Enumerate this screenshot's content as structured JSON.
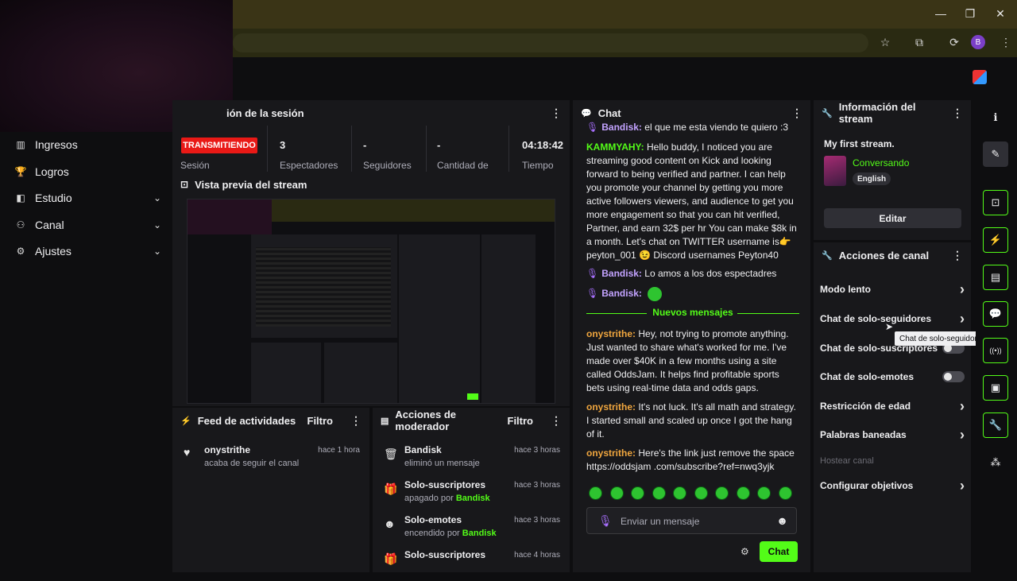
{
  "browser": {
    "window_controls": [
      "—",
      "❐",
      "✕"
    ],
    "toolbar_icons": [
      "☆",
      "⧉",
      "⟳"
    ],
    "profile_initial": "B"
  },
  "leftnav": {
    "items": [
      {
        "label": "Ingresos",
        "icon": "chart-icon",
        "glyph": "▥",
        "expandable": false
      },
      {
        "label": "Logros",
        "icon": "trophy-icon",
        "glyph": "🏆",
        "expandable": false
      },
      {
        "label": "Estudio",
        "icon": "studio-icon",
        "glyph": "◧",
        "expandable": true
      },
      {
        "label": "Canal",
        "icon": "users-icon",
        "glyph": "⚇",
        "expandable": true
      },
      {
        "label": "Ajustes",
        "icon": "gear-icon",
        "glyph": "⚙",
        "expandable": true
      }
    ]
  },
  "session": {
    "title": "ión de la sesión",
    "live_badge": "TRANSMITIENDO",
    "stats": [
      {
        "value": "",
        "label": "Sesión"
      },
      {
        "value": "3",
        "label": "Espectadores"
      },
      {
        "value": "-",
        "label": "Seguidores"
      },
      {
        "value": "-",
        "label": "Cantidad de"
      },
      {
        "value": "04:18:42",
        "label": "Tiempo"
      }
    ]
  },
  "preview": {
    "title": "Vista previa del stream"
  },
  "feed": {
    "title": "Feed de actividades",
    "filter": "Filtro",
    "items": [
      {
        "user": "onystrithe",
        "action": "acaba de seguir el canal",
        "time": "hace 1 hora"
      }
    ]
  },
  "mod_actions": {
    "title": "Acciones de moderador",
    "filter": "Filtro",
    "items": [
      {
        "title": "Bandisk",
        "sub": "eliminó un mensaje",
        "by": "",
        "time": "hace 3 horas",
        "icon": "trash-icon",
        "glyph": "🗑"
      },
      {
        "title": "Solo-suscriptores",
        "sub": "apagado por",
        "by": "Bandisk",
        "time": "hace 3 horas",
        "icon": "gift-icon",
        "glyph": "🎁"
      },
      {
        "title": "Solo-emotes",
        "sub": "encendido por",
        "by": "Bandisk",
        "time": "hace 3 horas",
        "icon": "smile-icon",
        "glyph": "☻"
      },
      {
        "title": "Solo-suscriptores",
        "sub": "",
        "by": "",
        "time": "hace 4 horas",
        "icon": "gift-icon",
        "glyph": "🎁"
      }
    ]
  },
  "chat": {
    "title": "Chat",
    "messages": [
      {
        "user": "Bandisk",
        "color": "purple",
        "text": "el que me esta viendo te quiero :3",
        "mic": true
      },
      {
        "user": "KAMMYAHY",
        "color": "green",
        "text": "Hello buddy, I noticed you are streaming good content on Kick and looking forward to being verified and partner. I can help you promote your channel by getting you more active followers viewers, and audience to get you more engagement so that you can hit verified, Partner, and earn 32$ per hr You can make $8k in a month. Let's chat on TWITTER username is👉 peyton_001 😉 Discord usernames Peyton40",
        "mic": false
      },
      {
        "user": "Bandisk",
        "color": "purple",
        "text": "Lo amos a los dos espectadres",
        "mic": true
      },
      {
        "user": "Bandisk",
        "color": "purple",
        "text": "",
        "mic": true
      }
    ],
    "new_messages_label": "Nuevos mensajes",
    "new_messages": [
      {
        "user": "onystrithe",
        "text": "Hey, not trying to promote anything. Just wanted to share what's worked for me. I've made over $40K in a few months using a site called OddsJam. It helps find profitable sports bets using real-time data and odds gaps."
      },
      {
        "user": "onystrithe",
        "text": "It's not luck. It's all math and strategy. I started small and scaled up once I got the hang of it."
      },
      {
        "user": "onystrithe",
        "text": "Here's the link just remove the space https://oddsjam .com/subscribe?ref=nwq3yjk"
      }
    ],
    "input_placeholder": "Enviar un mensaje",
    "send_label": "Chat"
  },
  "stream_info": {
    "title": "Información del stream",
    "stream_title": "My first stream.",
    "category": "Conversando",
    "language": "English",
    "edit_label": "Editar"
  },
  "channel_actions": {
    "title": "Acciones de canal",
    "items": [
      {
        "label": "Modo lento",
        "type": "chevron",
        "disabled": false
      },
      {
        "label": "Chat de solo-seguidores",
        "type": "chevron",
        "disabled": false
      },
      {
        "label": "Chat de solo-suscriptores",
        "type": "toggle",
        "disabled": false
      },
      {
        "label": "Chat de solo-emotes",
        "type": "toggle",
        "disabled": false
      },
      {
        "label": "Restricción de edad",
        "type": "chevron",
        "disabled": false
      },
      {
        "label": "Palabras baneadas",
        "type": "chevron",
        "disabled": false
      },
      {
        "label": "Hostear canal",
        "type": "none",
        "disabled": true
      },
      {
        "label": "Configurar objetivos",
        "type": "chevron",
        "disabled": false
      }
    ],
    "tooltip": "Chat de solo-seguidores"
  },
  "rightbar": {
    "buttons": [
      {
        "icon": "info-icon",
        "glyph": "ℹ",
        "style": "plain"
      },
      {
        "icon": "pencil-icon",
        "glyph": "✎",
        "style": "fill"
      },
      {
        "icon": "capture-icon",
        "glyph": "⊡",
        "style": "outline"
      },
      {
        "icon": "bolt-icon",
        "glyph": "⚡",
        "style": "outline"
      },
      {
        "icon": "notes-icon",
        "glyph": "▤",
        "style": "outline"
      },
      {
        "icon": "chat-icon",
        "glyph": "💬",
        "style": "outline"
      },
      {
        "icon": "broadcast-icon",
        "glyph": "((•))",
        "style": "outline"
      },
      {
        "icon": "video-icon",
        "glyph": "▣",
        "style": "outline"
      },
      {
        "icon": "wrench-icon",
        "glyph": "🔧",
        "style": "outline"
      },
      {
        "icon": "nodes-icon",
        "glyph": "⁂",
        "style": "plain"
      }
    ]
  },
  "colors": {
    "accent": "#53fc18",
    "live": "#e91916",
    "panel": "#18181b",
    "background": "#0e0e10"
  }
}
